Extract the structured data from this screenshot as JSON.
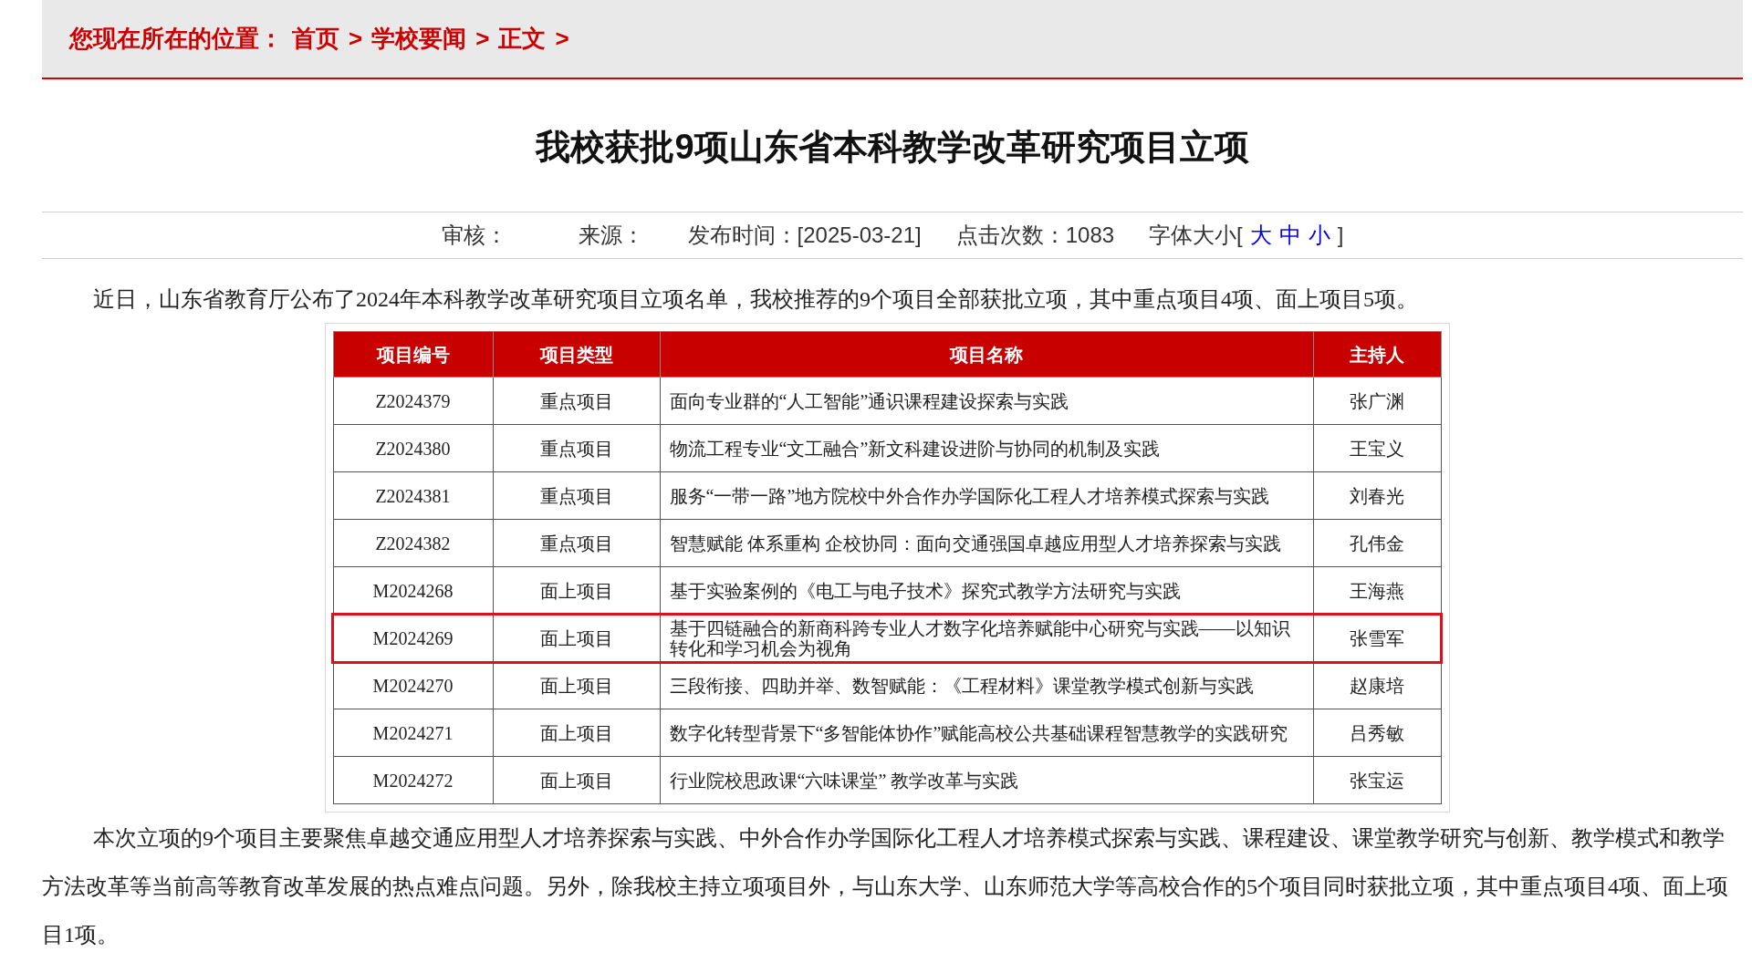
{
  "breadcrumb": {
    "label": "您现在所在的位置：",
    "separator": ">",
    "items": [
      "首页",
      "学校要闻",
      "正文"
    ]
  },
  "article": {
    "title": "我校获批9项山东省本科教学改革研究项目立项",
    "meta": {
      "review": "审核：",
      "source": "来源：",
      "date": "发布时间：[2025-03-21]",
      "clicks": "点击次数：1083",
      "font_size_label": "字体大小[",
      "font_sizes": [
        "大",
        "中",
        "小"
      ],
      "font_size_close": "]"
    },
    "intro": "近日，山东省教育厅公布了2024年本科教学改革研究项目立项名单，我校推荐的9个项目全部获批立项，其中重点项目4项、面上项目5项。",
    "table": {
      "columns": [
        "项目编号",
        "项目类型",
        "项目名称",
        "主持人"
      ],
      "rows": [
        {
          "cells": [
            "Z2024379",
            "重点项目",
            "面向专业群的“人工智能”通识课程建设探索与实践",
            "张广渊"
          ],
          "highlighted": false
        },
        {
          "cells": [
            "Z2024380",
            "重点项目",
            "物流工程专业“文工融合”新文科建设进阶与协同的机制及实践",
            "王宝义"
          ],
          "highlighted": false
        },
        {
          "cells": [
            "Z2024381",
            "重点项目",
            "服务“一带一路”地方院校中外合作办学国际化工程人才培养模式探索与实践",
            "刘春光"
          ],
          "highlighted": false
        },
        {
          "cells": [
            "Z2024382",
            "重点项目",
            "智慧赋能 体系重构 企校协同：面向交通强国卓越应用型人才培养探索与实践",
            "孔伟金"
          ],
          "highlighted": false
        },
        {
          "cells": [
            "M2024268",
            "面上项目",
            "基于实验案例的《电工与电子技术》探究式教学方法研究与实践",
            "王海燕"
          ],
          "highlighted": false
        },
        {
          "cells": [
            "M2024269",
            "面上项目",
            "基于四链融合的新商科跨专业人才数字化培养赋能中心研究与实践——以知识转化和学习机会为视角",
            "张雪军"
          ],
          "highlighted": true
        },
        {
          "cells": [
            "M2024270",
            "面上项目",
            "三段衔接、四助并举、数智赋能：《工程材料》课堂教学模式创新与实践",
            "赵康培"
          ],
          "highlighted": false
        },
        {
          "cells": [
            "M2024271",
            "面上项目",
            "数字化转型背景下“多智能体协作”赋能高校公共基础课程智慧教学的实践研究",
            "吕秀敏"
          ],
          "highlighted": false
        },
        {
          "cells": [
            "M2024272",
            "面上项目",
            "行业院校思政课“六味课堂” 教学改革与实践",
            "张宝运"
          ],
          "highlighted": false
        }
      ]
    },
    "summary": "本次立项的9个项目主要聚焦卓越交通应用型人才培养探索与实践、中外合作办学国际化工程人才培养模式探索与实践、课程建设、课堂教学研究与创新、教学模式和教学方法改革等当前高等教育改革发展的热点难点问题。另外，除我校主持立项项目外，与山东大学、山东师范大学等高校合作的5个项目同时获批立项，其中重点项目4项、面上项目1项。"
  }
}
